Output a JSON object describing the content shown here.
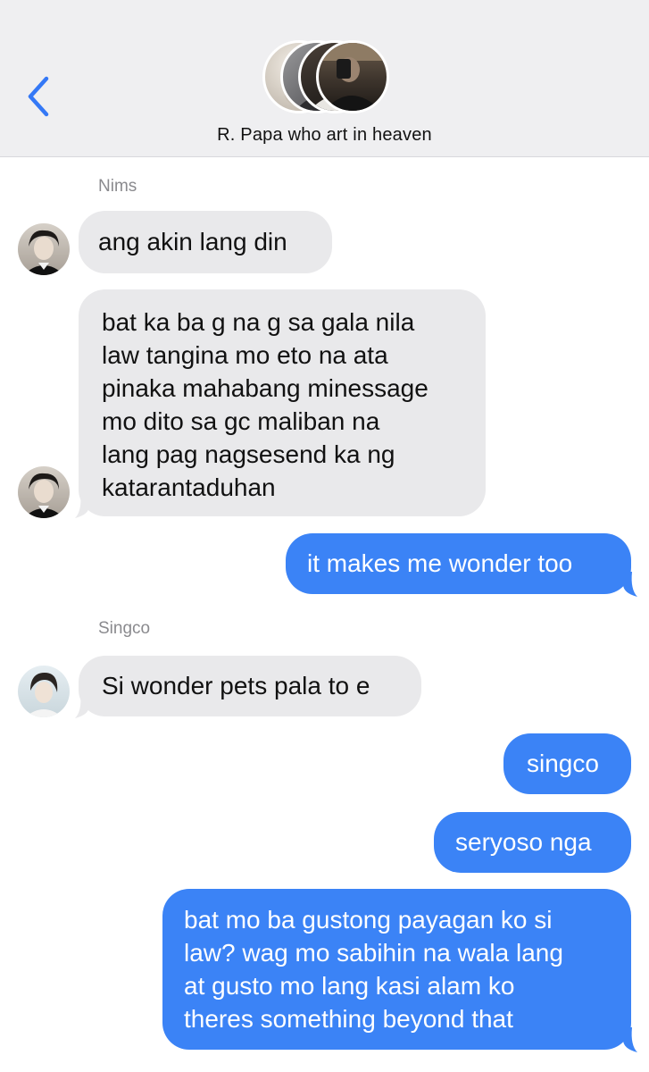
{
  "header": {
    "title": "R. Papa who art in heaven",
    "back_icon": "chevron-left-icon",
    "avatar_count": 4
  },
  "colors": {
    "header_bg": "#efeff1",
    "incoming_bubble": "#e9e9eb",
    "outgoing_bubble": "#3b83f6",
    "accent": "#3478f6",
    "sender_name": "#8a8a8e"
  },
  "messages": [
    {
      "type": "sender",
      "text": "Nims"
    },
    {
      "type": "in",
      "text": "ang akin lang din"
    },
    {
      "type": "in",
      "text": "bat ka ba g na g sa gala nila\nlaw tangina mo eto na ata\npinaka mahabang minessage\nmo dito sa gc maliban na\nlang pag nagsesend ka ng\nkatarantaduhan"
    },
    {
      "type": "out",
      "text": "it makes me wonder too"
    },
    {
      "type": "sender",
      "text": "Singco"
    },
    {
      "type": "in",
      "text": "Si wonder pets pala to e"
    },
    {
      "type": "out",
      "text": "singco"
    },
    {
      "type": "out",
      "text": "seryoso nga"
    },
    {
      "type": "out",
      "text": "bat mo ba gustong payagan ko si\nlaw? wag mo sabihin na wala lang\nat gusto mo lang kasi alam ko\ntheres something beyond that"
    }
  ]
}
